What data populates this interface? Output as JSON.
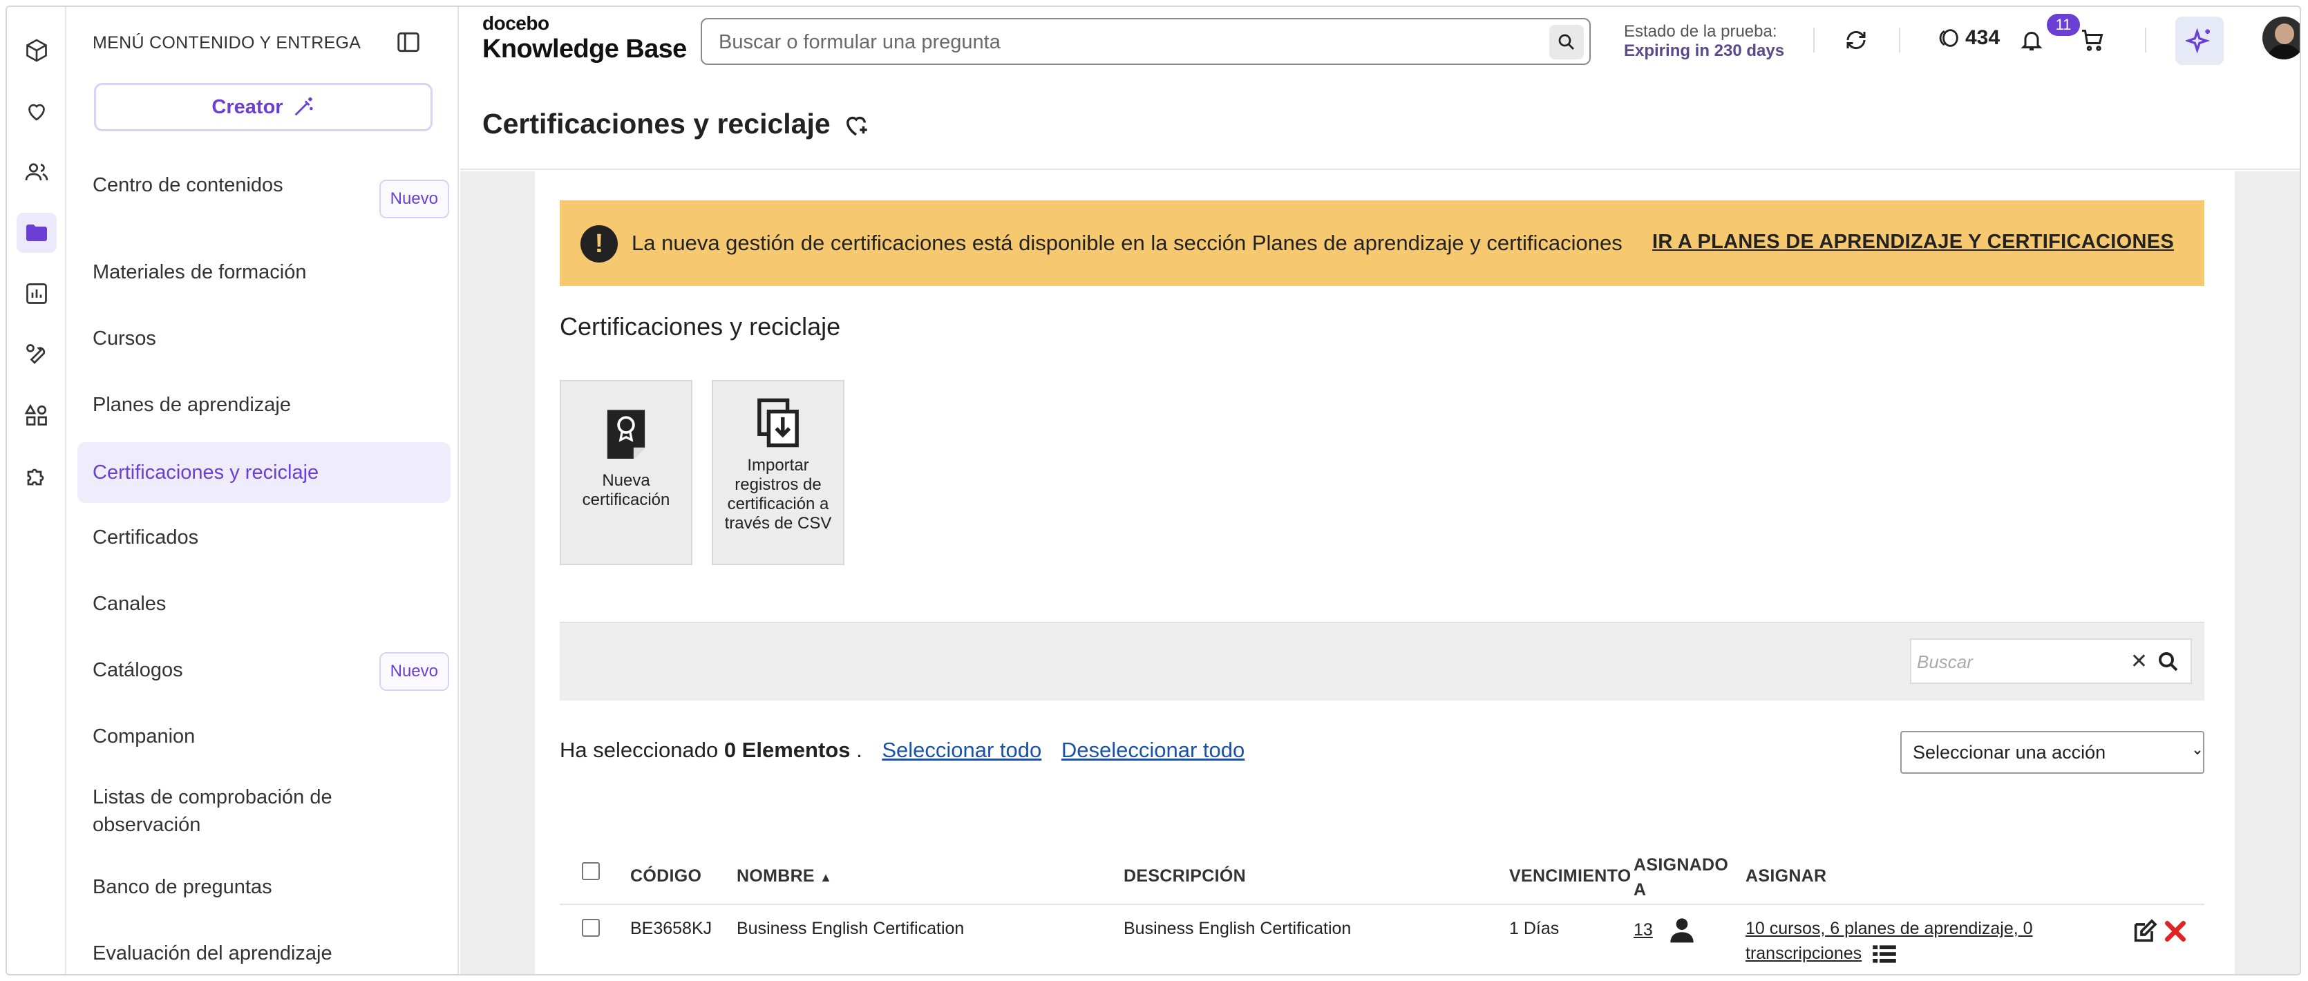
{
  "sidebar": {
    "header": "MENÚ CONTENIDO Y ENTREGA",
    "creator_label": "Creator",
    "items": [
      {
        "label": "Centro de contenidos",
        "badge": "Nuevo"
      },
      {
        "label": "Materiales de formación"
      },
      {
        "label": "Cursos"
      },
      {
        "label": "Planes de aprendizaje"
      },
      {
        "label": "Certificaciones y reciclaje",
        "active": true
      },
      {
        "label": "Certificados"
      },
      {
        "label": "Canales"
      },
      {
        "label": "Catálogos",
        "badge": "Nuevo"
      },
      {
        "label": "Companion"
      },
      {
        "label": "Listas de comprobación de observación"
      },
      {
        "label": "Banco de preguntas"
      },
      {
        "label": "Evaluación del aprendizaje"
      }
    ]
  },
  "rail": {
    "icons": [
      "cube-icon",
      "heart-icon",
      "users-icon",
      "folder-icon",
      "report-icon",
      "wrench-icon",
      "apps-icon",
      "puzzle-icon"
    ]
  },
  "topbar": {
    "logo_top": "docebo",
    "logo_bottom": "Knowledge Base",
    "search_placeholder": "Buscar o formular una pregunta",
    "trial_label": "Estado de la prueba:",
    "trial_value": "Expiring in 230 days",
    "coins": "434",
    "notifications": "11",
    "page_title": "Certificaciones y reciclaje"
  },
  "alert": {
    "text": "La nueva gestión de certificaciones está disponible en la sección Planes de aprendizaje y certificaciones",
    "link": "IR A PLANES DE APRENDIZAJE Y CERTIFICACIONES"
  },
  "section_title": "Certificaciones y reciclaje",
  "tiles": [
    {
      "label": "Nueva certificación"
    },
    {
      "label": "Importar registros de certificación a través de CSV"
    }
  ],
  "filter": {
    "search_placeholder": "Buscar"
  },
  "selection": {
    "prefix": "Ha seleccionado",
    "count": "0 Elementos",
    "suffix": ".",
    "select_all": "Seleccionar todo",
    "deselect_all": "Deseleccionar todo"
  },
  "action_select": {
    "selected": "Seleccionar una acción"
  },
  "table": {
    "headers": {
      "code": "CÓDIGO",
      "name": "NOMBRE",
      "description": "DESCRIPCIÓN",
      "expiry": "VENCIMIENTO",
      "assigned_to": "ASIGNADO A",
      "assign": "ASIGNAR"
    },
    "rows": [
      {
        "code": "BE3658KJ",
        "name": "Business English Certification",
        "description": "Business English Certification",
        "expiry": "1 Días",
        "assigned_count": "13",
        "assign_text": "10 cursos, 6 planes de aprendizaje, 0 transcripciones"
      }
    ]
  },
  "colors": {
    "accent": "#6b3fd4",
    "alert_bg": "#f6c971",
    "link": "#1a52a8",
    "delete": "#e02424"
  }
}
